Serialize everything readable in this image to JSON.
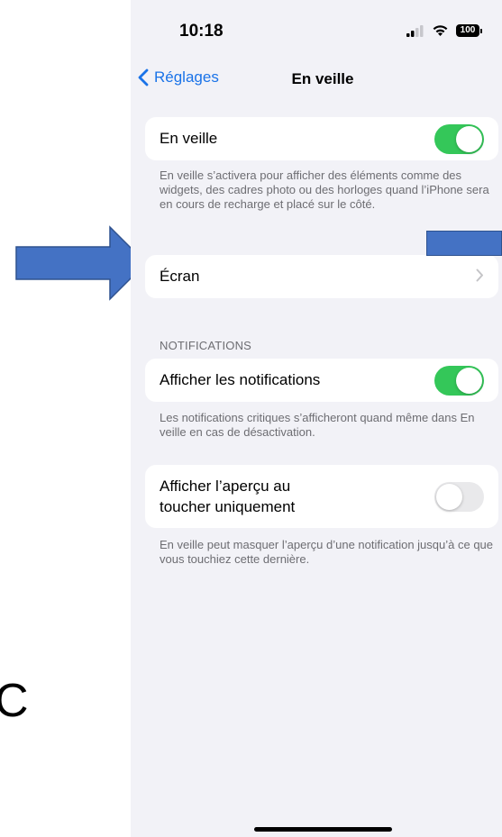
{
  "status_bar": {
    "time": "10:18",
    "battery": "100",
    "icons": [
      "signal-icon",
      "wifi-icon",
      "battery-icon"
    ]
  },
  "nav": {
    "back_label": "Réglages",
    "title": "En veille"
  },
  "standby": {
    "label": "En veille",
    "toggle_on": true,
    "footnote": "En veille s’activera pour afficher des éléments comme des widgets, des cadres photo ou des horloges quand l’iPhone sera en cours de recharge et placé sur le côté."
  },
  "display": {
    "label": "Écran"
  },
  "notifications": {
    "section_header": "NOTIFICATIONS",
    "show_label": "Afficher les notifications",
    "show_toggle_on": true,
    "show_footnote": "Les notifications critiques s’afficheront quand même dans En veille en cas de désactivation.",
    "preview_label_line1": "Afficher l’aperçu au",
    "preview_label_line2": "toucher uniquement",
    "preview_toggle_on": false,
    "preview_footnote": "En veille peut masquer l’aperçu d’une notification jusqu’à ce que vous touchiez cette dernière."
  },
  "annotation": {
    "stray_text": "C"
  },
  "colors": {
    "accent": "#1a73e8",
    "toggle_on": "#34c759",
    "toggle_off": "#e9e9eb",
    "background": "#f2f2f7",
    "annotation_arrow": "#4472c4"
  }
}
